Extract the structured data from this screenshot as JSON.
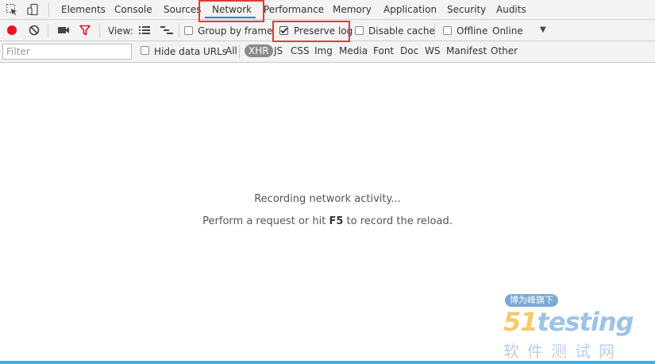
{
  "tabs": {
    "items": [
      "Elements",
      "Console",
      "Sources",
      "Network",
      "Performance",
      "Memory",
      "Application",
      "Security",
      "Audits"
    ],
    "active": "Network"
  },
  "toolbar": {
    "view_label": "View:",
    "group_by_frame": {
      "label": "Group by frame",
      "checked": false
    },
    "preserve_log": {
      "label": "Preserve log",
      "checked": true
    },
    "disable_cache": {
      "label": "Disable cache",
      "checked": false
    },
    "offline": {
      "label": "Offline",
      "checked": false
    },
    "throttling": {
      "value": "Online"
    }
  },
  "filterbar": {
    "filter": {
      "placeholder": "Filter",
      "value": ""
    },
    "hide_data_urls": {
      "label": "Hide data URLs",
      "checked": false
    },
    "types": [
      "All",
      "XHR",
      "JS",
      "CSS",
      "Img",
      "Media",
      "Font",
      "Doc",
      "WS",
      "Manifest",
      "Other"
    ],
    "active_type": "XHR"
  },
  "empty_state": {
    "line1": "Recording network activity...",
    "line2_before": "Perform a request or hit ",
    "line2_key": "F5",
    "line2_after": " to record the reload."
  },
  "watermark": {
    "badge": "博为峰旗下",
    "logo_number": "51",
    "logo_word": "testing",
    "subtitle": "软件测试网"
  },
  "colors": {
    "highlight": "#e03a3a",
    "record": "#e81123",
    "active_tab_underline": "#3879d9",
    "bottom_accent": "#3bb3e6"
  }
}
